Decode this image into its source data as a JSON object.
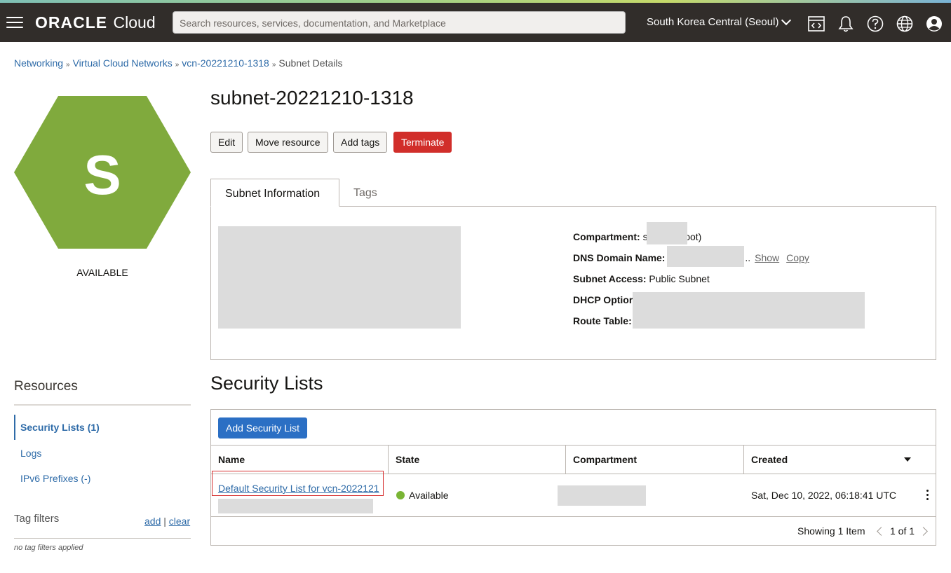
{
  "header": {
    "brand_bold": "ORACLE",
    "brand_light": "Cloud",
    "search_placeholder": "Search resources, services, documentation, and Marketplace",
    "region": "South Korea Central (Seoul)",
    "icons": [
      "menu-icon",
      "cloud-shell-icon",
      "bell-icon",
      "help-icon",
      "globe-icon",
      "profile-icon"
    ]
  },
  "breadcrumb": {
    "items": [
      "Networking",
      "Virtual Cloud Networks",
      "vcn-20221210-1318"
    ],
    "current": "Subnet Details"
  },
  "resource": {
    "letter": "S",
    "status": "AVAILABLE",
    "title": "subnet-20221210-1318",
    "hex_color": "#80aa3d"
  },
  "actions": {
    "edit": "Edit",
    "move": "Move resource",
    "add_tags": "Add tags",
    "terminate": "Terminate"
  },
  "tabs": {
    "info": "Subnet Information",
    "tags": "Tags"
  },
  "info": {
    "compartment_label": "Compartment:",
    "compartment_prefix": "s",
    "compartment_suffix": "root)",
    "dns_label": "DNS Domain Name:",
    "dns_ellipsis": "..",
    "show": "Show",
    "copy": "Copy",
    "access_label": "Subnet Access:",
    "access_value": "Public Subnet",
    "dhcp_label": "DHCP Optior",
    "route_label": "Route Table:"
  },
  "resources": {
    "title": "Resources",
    "items": [
      "Security Lists (1)",
      "Logs",
      "IPv6 Prefixes (-)"
    ],
    "tag_filters": "Tag filters",
    "add": "add",
    "divider": "|",
    "clear": "clear",
    "no_filters": "no tag filters applied"
  },
  "security_lists": {
    "title": "Security Lists",
    "add_button": "Add Security List",
    "columns": [
      "Name",
      "State",
      "Compartment",
      "Created"
    ],
    "rows": [
      {
        "name": "Default Security List for vcn-2022121",
        "state": "Available",
        "created": "Sat, Dec 10, 2022, 06:18:41 UTC"
      }
    ],
    "showing": "Showing 1 Item",
    "page": "1 of 1"
  },
  "colors": {
    "topbar": "#312d2a",
    "link": "#2e6ba8",
    "danger": "#d12e2a",
    "primary": "#2b6fc4",
    "available_dot": "#7ab535"
  }
}
